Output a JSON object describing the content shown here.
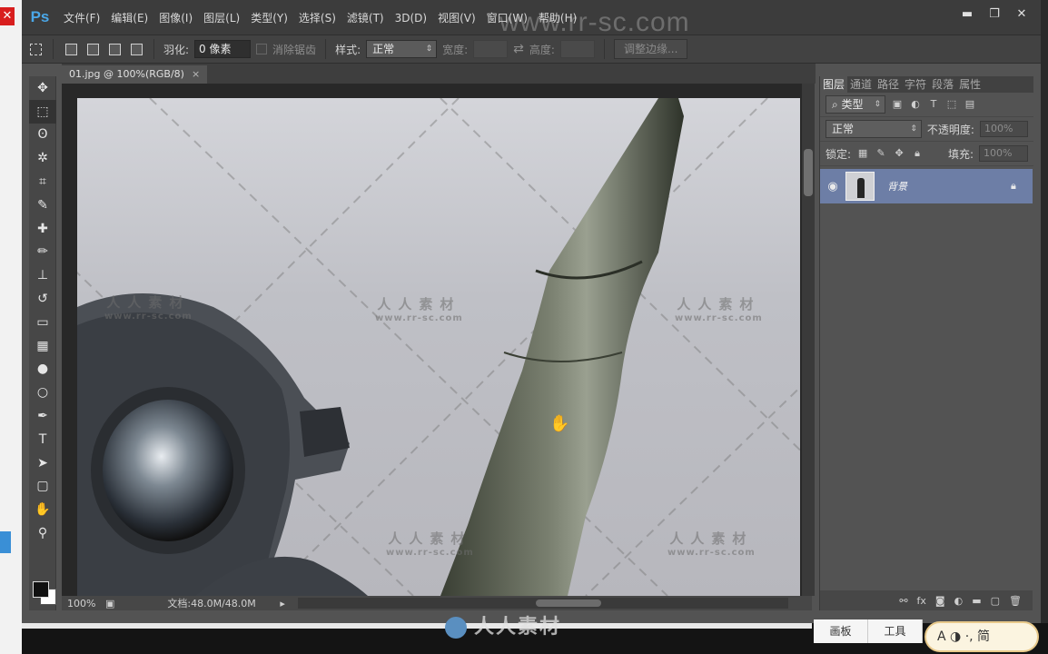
{
  "app": {
    "logo": "Ps"
  },
  "menu": [
    "文件(F)",
    "编辑(E)",
    "图像(I)",
    "图层(L)",
    "类型(Y)",
    "选择(S)",
    "滤镜(T)",
    "3D(D)",
    "视图(V)",
    "窗口(W)",
    "帮助(H)"
  ],
  "window_controls": {
    "minimize": "▬",
    "restore": "❐",
    "close": "✕"
  },
  "watermark_top": "www.rr-sc.com",
  "options": {
    "feather_label": "羽化:",
    "feather_value": "0 像素",
    "antialias_label": "消除锯齿",
    "style_label": "样式:",
    "style_value": "正常",
    "width_label": "宽度:",
    "height_label": "高度:",
    "refine_edge": "调整边缘..."
  },
  "document": {
    "tab_title": "01.jpg @ 100%(RGB/8)",
    "tab_close": "×",
    "zoom": "100%",
    "doc_size": "文档:48.0M/48.0M"
  },
  "canvas_watermarks": [
    {
      "cn": "人人素材",
      "en": "www.rr-sc.com"
    },
    {
      "cn": "人人素材",
      "en": "www.rr-sc.com"
    },
    {
      "cn": "人人素材",
      "en": "www.rr-sc.com"
    },
    {
      "cn": "人人素材",
      "en": "www.rr-sc.com"
    },
    {
      "cn": "人人素材",
      "en": "www.rr-sc.com"
    }
  ],
  "tools": [
    "move-icon",
    "marquee-icon",
    "lasso-icon",
    "magic-wand-icon",
    "crop-icon",
    "eyedropper-icon",
    "healing-icon",
    "brush-icon",
    "stamp-icon",
    "history-brush-icon",
    "eraser-icon",
    "gradient-icon",
    "blur-icon",
    "dodge-icon",
    "pen-icon",
    "type-icon",
    "path-select-icon",
    "shape-icon",
    "hand-icon",
    "zoom-icon"
  ],
  "tool_glyphs": [
    "✥",
    "⬚",
    "ʘ",
    "✲",
    "⌗",
    "✎",
    "✚",
    "✏",
    "⊥",
    "↺",
    "▭",
    "▦",
    "●",
    "○",
    "✒",
    "T",
    "➤",
    "▢",
    "✋",
    "⚲"
  ],
  "panel": {
    "tabs": [
      "图层",
      "通道",
      "路径",
      "字符",
      "段落",
      "属性"
    ],
    "kind_filter": "类型",
    "blend_mode": "正常",
    "opacity_label": "不透明度:",
    "opacity_value": "100%",
    "lock_label": "锁定:",
    "fill_label": "填充:",
    "fill_value": "100%",
    "layer": {
      "name": "背景"
    }
  },
  "taskbar": {
    "tab1": "画板",
    "tab2": "工具",
    "ime": "A ◑ ·, 简"
  },
  "bottom_watermark": "人人素材"
}
